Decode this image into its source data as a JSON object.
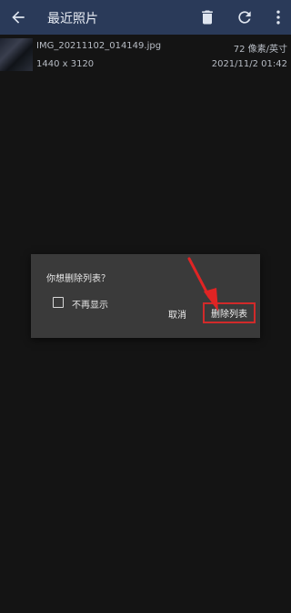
{
  "header": {
    "title": "最近照片",
    "icons": [
      "back-arrow-icon",
      "trash-icon",
      "refresh-icon",
      "more-vert-icon"
    ]
  },
  "file": {
    "name": "IMG_20211102_014149.jpg",
    "resolution": "1440 x 3120",
    "dpi": "72 像素/英寸",
    "date": "2021/11/2 01:42"
  },
  "dialog": {
    "message": "你想删除列表？",
    "checkbox_label": "不再显示",
    "checkbox_checked": false,
    "cancel_label": "取消",
    "delete_label": "删除列表"
  },
  "colors": {
    "appbar": "#2a3a59",
    "dialog_bg": "#3a3a3a",
    "highlight": "#d12a2a"
  }
}
